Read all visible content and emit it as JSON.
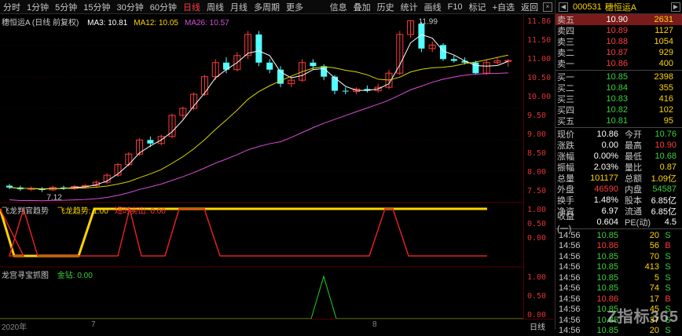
{
  "toolbar": {
    "items": [
      "分时",
      "1分钟",
      "5分钟",
      "15分钟",
      "30分钟",
      "60分钟",
      "日线",
      "周线",
      "月线",
      "多周期",
      "更多"
    ],
    "active_index": 6,
    "right_items": [
      "信息",
      "叠加",
      "历史",
      "统计",
      "画线",
      "F10",
      "标记",
      "+自选",
      "返回"
    ]
  },
  "main_chart": {
    "title": "穗恒运A (日线 前复权)",
    "ma_labels": [
      {
        "text": "MA3: 10.81",
        "color": "#ffffff"
      },
      {
        "text": "MA12: 10.05",
        "color": "#ffd400"
      },
      {
        "text": "MA26: 10.57",
        "color": "#d94dd9"
      }
    ],
    "annotation_high": "11.99",
    "annotation_low": "7.12",
    "y_ticks": [
      "11.86",
      "11.50",
      "11.00",
      "10.50",
      "10.00",
      "9.50",
      "9.00",
      "8.50",
      "8.00",
      "7.50"
    ]
  },
  "indicator1": {
    "title": "飞龙判官趋势",
    "labels": [
      {
        "text": "飞龙趋势: 1.00",
        "color": "#ffd400"
      },
      {
        "text": "短时卖出: 0.00",
        "color": "#ff3b3b"
      }
    ],
    "y_ticks": [
      "1.00",
      "0.50",
      "0.00"
    ]
  },
  "indicator2": {
    "title": "龙宫寻宝抓图",
    "labels": [
      {
        "text": "金钻: 0.00",
        "color": "#3bd13b"
      }
    ],
    "y_ticks": [
      "1.00",
      "0.50",
      "0.00"
    ]
  },
  "bottom": {
    "dates": [
      "2020年",
      "7",
      "8"
    ],
    "period_label": "日线"
  },
  "panel": {
    "code": "000531",
    "name": "穗恒运A",
    "sell": [
      {
        "label": "卖五",
        "price": "10.90",
        "vol": "2631"
      },
      {
        "label": "卖四",
        "price": "10.89",
        "vol": "1127"
      },
      {
        "label": "卖三",
        "price": "10.88",
        "vol": "1054"
      },
      {
        "label": "卖二",
        "price": "10.87",
        "vol": "929"
      },
      {
        "label": "卖一",
        "price": "10.86",
        "vol": "400"
      }
    ],
    "buy": [
      {
        "label": "买一",
        "price": "10.85",
        "vol": "2398"
      },
      {
        "label": "买二",
        "price": "10.84",
        "vol": "355"
      },
      {
        "label": "买三",
        "price": "10.83",
        "vol": "416"
      },
      {
        "label": "买四",
        "price": "10.82",
        "vol": "102"
      },
      {
        "label": "买五",
        "price": "10.81",
        "vol": "95"
      }
    ],
    "stats": [
      {
        "k": "现价",
        "v": "10.86",
        "vc": "white",
        "k2": "今开",
        "v2": "10.76",
        "v2c": "green"
      },
      {
        "k": "涨跌",
        "v": "0.00",
        "vc": "white",
        "k2": "最高",
        "v2": "10.90",
        "v2c": "red"
      },
      {
        "k": "涨幅",
        "v": "0.00%",
        "vc": "white",
        "k2": "最低",
        "v2": "10.68",
        "v2c": "green"
      },
      {
        "k": "振幅",
        "v": "2.03%",
        "vc": "white",
        "k2": "量比",
        "v2": "0.87",
        "v2c": "yellow"
      },
      {
        "k": "总量",
        "v": "101177",
        "vc": "yellow",
        "k2": "总额",
        "v2": "1.09亿",
        "v2c": "yellow"
      },
      {
        "k": "外盘",
        "v": "46590",
        "vc": "red",
        "k2": "内盘",
        "v2": "54587",
        "v2c": "green"
      },
      {
        "k": "换手",
        "v": "1.48%",
        "vc": "white",
        "k2": "股本",
        "v2": "6.85亿",
        "v2c": "white"
      },
      {
        "k": "净资",
        "v": "6.97",
        "vc": "white",
        "k2": "流通",
        "v2": "6.85亿",
        "v2c": "white"
      },
      {
        "k": "收益(一)",
        "v": "0.604",
        "vc": "white",
        "k2": "PE(动)",
        "v2": "4.5",
        "v2c": "white"
      }
    ],
    "ticks": [
      {
        "t": "14:56",
        "p": "10.85",
        "q": "20",
        "s": "S",
        "sc": "green"
      },
      {
        "t": "14:56",
        "p": "10.86",
        "q": "56",
        "s": "B",
        "sc": "red"
      },
      {
        "t": "14:56",
        "p": "10.85",
        "q": "70",
        "s": "S",
        "sc": "green"
      },
      {
        "t": "14:56",
        "p": "10.85",
        "q": "413",
        "s": "S",
        "sc": "green"
      },
      {
        "t": "14:56",
        "p": "10.85",
        "q": "5",
        "s": "S",
        "sc": "green"
      },
      {
        "t": "14:56",
        "p": "10.85",
        "q": "74",
        "s": "S",
        "sc": "green"
      },
      {
        "t": "14:56",
        "p": "10.86",
        "q": "17",
        "s": "B",
        "sc": "red"
      },
      {
        "t": "14:56",
        "p": "10.85",
        "q": "45",
        "s": "S",
        "sc": "green"
      },
      {
        "t": "14:56",
        "p": "10.85",
        "q": "37",
        "s": "S",
        "sc": "green"
      },
      {
        "t": "14:56",
        "p": "10.85",
        "q": "20",
        "s": "S",
        "sc": "green"
      }
    ],
    "watermark": "Z指标365"
  }
}
